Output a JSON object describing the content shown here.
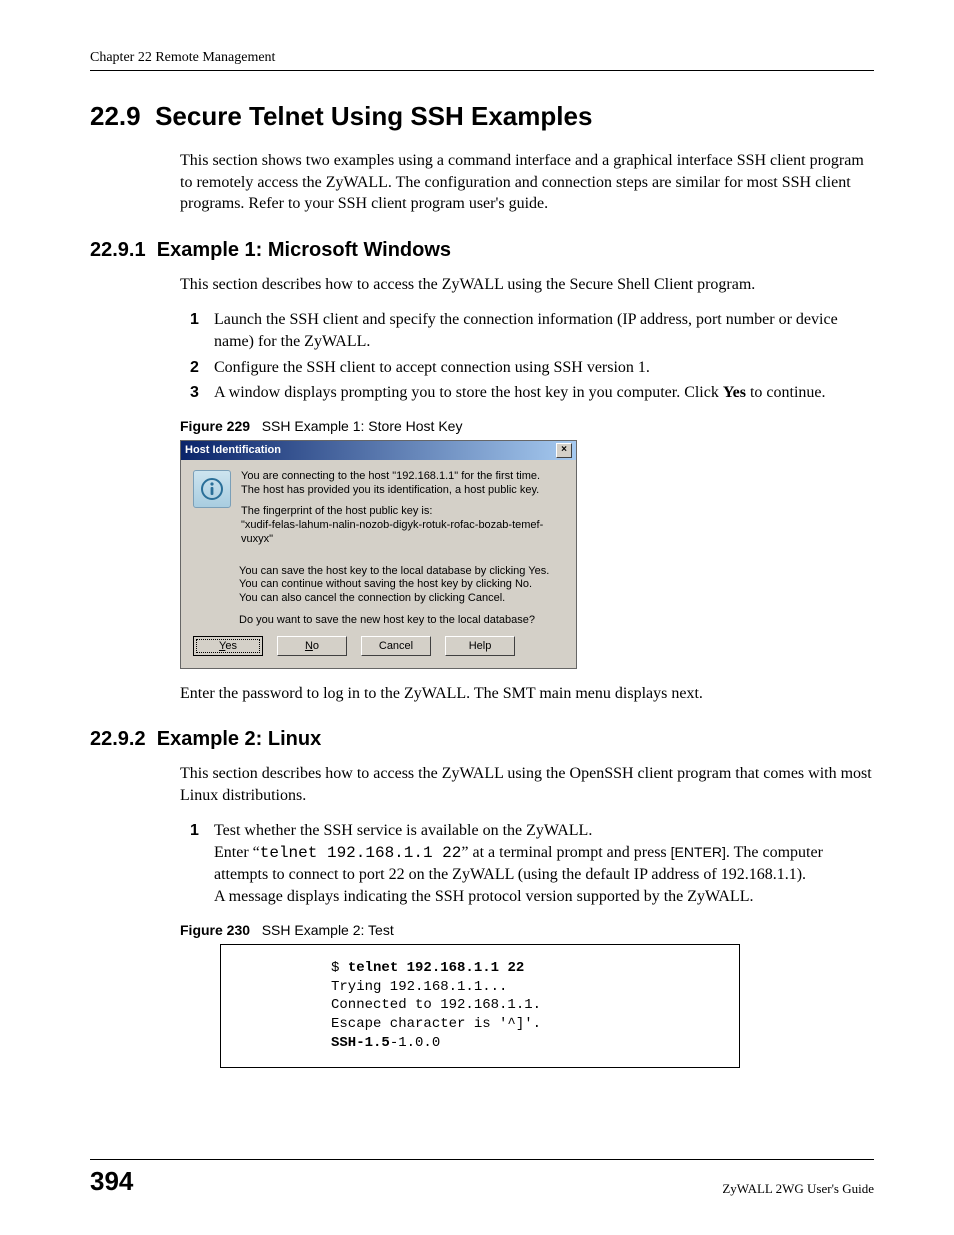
{
  "header": {
    "chapter": "Chapter 22 Remote Management"
  },
  "section": {
    "number": "22.9",
    "title": "Secure Telnet Using SSH Examples",
    "intro": "This section shows two examples using a command interface and a graphical interface SSH client program to remotely access the ZyWALL. The configuration and connection steps are similar for most SSH client programs. Refer to your SSH client program user's guide."
  },
  "sub1": {
    "number": "22.9.1",
    "title": "Example 1: Microsoft Windows",
    "intro": "This section describes how to access the ZyWALL using the Secure Shell Client program.",
    "steps": [
      "Launch the SSH client and specify the connection information (IP address, port number or device name) for the ZyWALL.",
      "Configure the SSH client to accept connection using SSH version 1.",
      "A window displays prompting you to store the host key in you computer. Click "
    ],
    "step3_bold": "Yes",
    "step3_tail": " to continue.",
    "after_fig": "Enter the password to log in to the ZyWALL. The SMT main menu displays next."
  },
  "figure229": {
    "label": "Figure 229",
    "caption": "SSH Example 1: Store Host Key",
    "dialog_title": "Host Identification",
    "line1": "You are connecting to the host \"192.168.1.1\" for the first time.",
    "line2": "The host has provided you its identification, a host public key.",
    "line3": "The fingerprint of the host public key is:",
    "fingerprint": "\"xudif-felas-lahum-nalin-nozob-digyk-rotuk-rofac-bozab-temef-vuxyx\"",
    "line4": "You can save the host key to the local database by clicking Yes.",
    "line5": "You can continue without saving the host key by clicking No.",
    "line6": "You can also cancel the connection by clicking Cancel.",
    "line7": "Do you want to save the new host key to the local database?",
    "btn_yes": "Yes",
    "btn_no": "No",
    "btn_cancel": "Cancel",
    "btn_help": "Help"
  },
  "sub2": {
    "number": "22.9.2",
    "title": "Example 2: Linux",
    "intro": "This section describes how to access the ZyWALL using the OpenSSH client program that comes with most Linux distributions.",
    "step1_text": "Test whether the SSH service is available on the ZyWALL.",
    "enter_prefix": "Enter “",
    "enter_cmd": "telnet 192.168.1.1 22",
    "enter_mid": "” at a terminal prompt and press ",
    "enter_key": "[ENTER]",
    "enter_tail": ". The computer attempts to connect to port 22 on the ZyWALL (using the default IP address of 192.168.1.1).",
    "msg_line": "A message displays indicating the SSH protocol version supported by the ZyWALL."
  },
  "figure230": {
    "label": "Figure 230",
    "caption": "SSH Example 2: Test",
    "term_prompt": "$ ",
    "term_cmd": "telnet 192.168.1.1 22",
    "term_l2": "Trying 192.168.1.1...",
    "term_l3": "Connected to 192.168.1.1.",
    "term_l4": "Escape character is '^]'.",
    "term_l5a": "SSH-1.5",
    "term_l5b": "-1.0.0"
  },
  "footer": {
    "page": "394",
    "guide": "ZyWALL 2WG User's Guide"
  }
}
